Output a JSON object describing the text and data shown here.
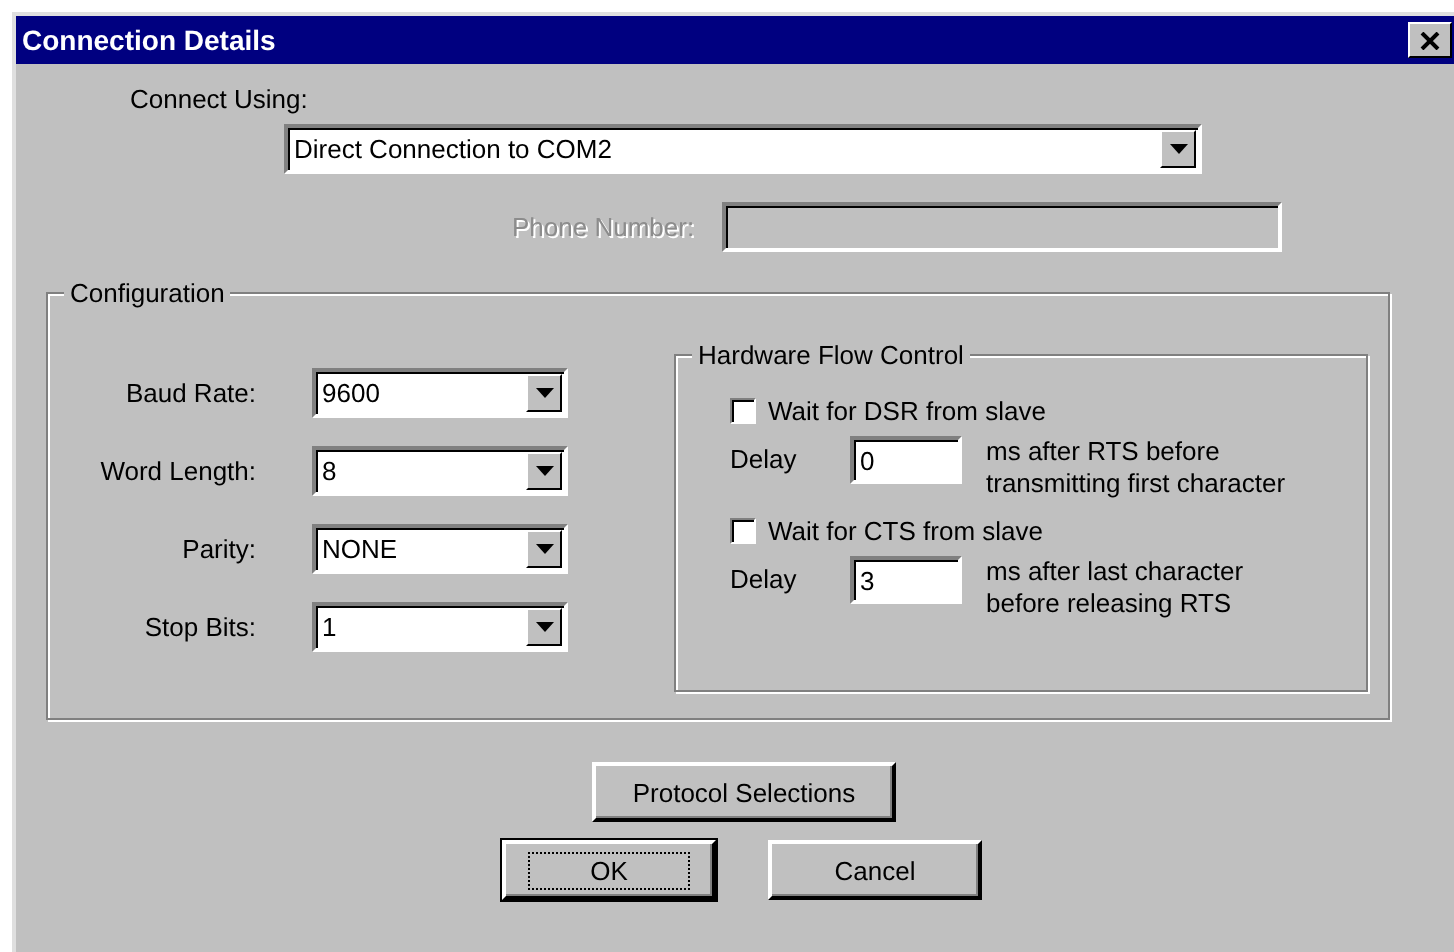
{
  "window": {
    "title": "Connection Details"
  },
  "connect_using": {
    "label": "Connect Using:",
    "value": "Direct Connection to COM2"
  },
  "phone_number": {
    "label": "Phone Number:",
    "disabled": true
  },
  "configuration": {
    "title": "Configuration",
    "fields": [
      {
        "label": "Baud Rate:",
        "value": "9600"
      },
      {
        "label": "Word Length:",
        "value": "8"
      },
      {
        "label": "Parity:",
        "value": "NONE"
      },
      {
        "label": "Stop Bits:",
        "value": "1"
      }
    ]
  },
  "hardware_flow_control": {
    "title": "Hardware Flow Control",
    "options": [
      {
        "label": "Wait for DSR from slave",
        "checked": false,
        "delay_label": "Delay",
        "delay": "0",
        "note_lines": [
          "ms after RTS before",
          "transmitting first character"
        ]
      },
      {
        "label": "Wait for CTS from slave",
        "checked": false,
        "delay_label": "Delay",
        "delay": "3",
        "note_lines": [
          "ms after last character",
          "before releasing RTS"
        ]
      }
    ]
  },
  "protocol_button": {
    "label": "Protocol Selections",
    "default": false
  },
  "buttons": [
    {
      "label": "OK",
      "default": true
    },
    {
      "label": "Cancel",
      "default": false
    }
  ]
}
